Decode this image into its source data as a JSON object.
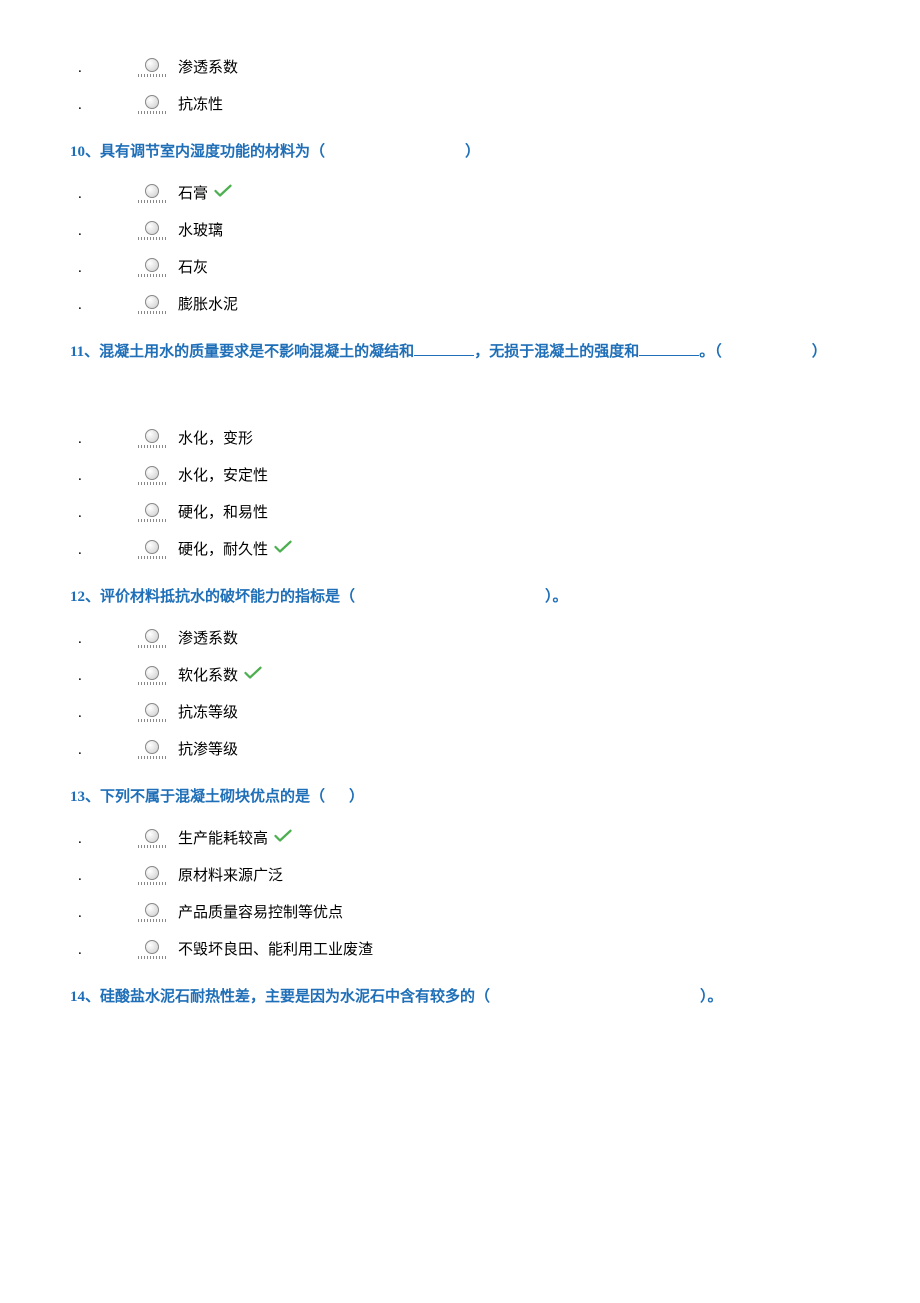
{
  "q9_tail": {
    "options": [
      {
        "text": "渗透系数",
        "correct": false
      },
      {
        "text": "抗冻性",
        "correct": false
      }
    ]
  },
  "q10": {
    "stem_pre": "10、具有调节室内湿度功能的材料为（",
    "stem_post": "）",
    "options": [
      {
        "text": "石膏",
        "correct": true
      },
      {
        "text": "水玻璃",
        "correct": false
      },
      {
        "text": "石灰",
        "correct": false
      },
      {
        "text": "膨胀水泥",
        "correct": false
      }
    ]
  },
  "q11": {
    "stem_a": "11、混凝土用水的质量要求是不影响混凝土的凝结和",
    "stem_b": "，无损于混凝土的强度和",
    "stem_c": "。（",
    "stem_d": "）",
    "options": [
      {
        "text": "水化，变形",
        "correct": false
      },
      {
        "text": "水化，安定性",
        "correct": false
      },
      {
        "text": "硬化，和易性",
        "correct": false
      },
      {
        "text": "硬化，耐久性",
        "correct": true
      }
    ]
  },
  "q12": {
    "stem_pre": "12、评价材料抵抗水的破坏能力的指标是（",
    "stem_post": "）。",
    "options": [
      {
        "text": "渗透系数",
        "correct": false
      },
      {
        "text": "软化系数",
        "correct": true
      },
      {
        "text": "抗冻等级",
        "correct": false
      },
      {
        "text": "抗渗等级",
        "correct": false
      }
    ]
  },
  "q13": {
    "stem_pre": "13、下列不属于混凝土砌块优点的是（",
    "stem_post": "）",
    "gap": "short",
    "options": [
      {
        "text": "生产能耗较高",
        "correct": true
      },
      {
        "text": "原材料来源广泛",
        "correct": false
      },
      {
        "text": "产品质量容易控制等优点",
        "correct": false
      },
      {
        "text": "不毁坏良田、能利用工业废渣",
        "correct": false
      }
    ]
  },
  "q14": {
    "stem_pre": "14、硅酸盐水泥石耐热性差，主要是因为水泥石中含有较多的（",
    "stem_post": "）。"
  }
}
